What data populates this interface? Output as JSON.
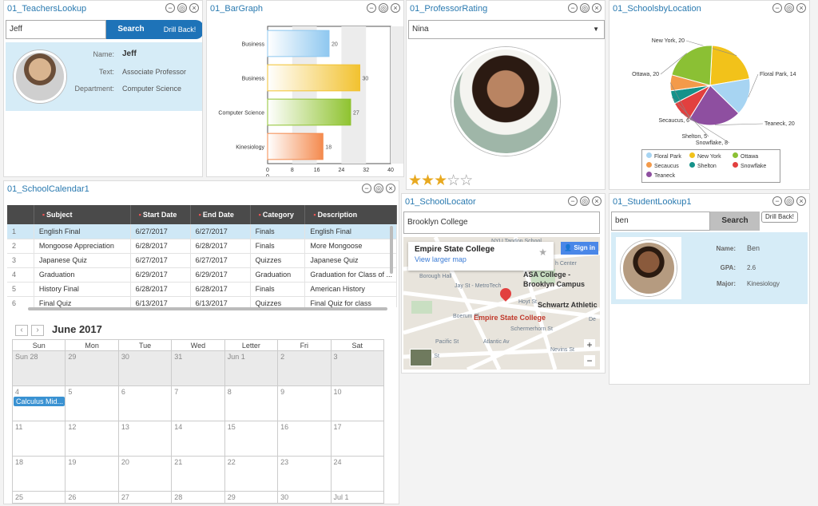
{
  "teachers": {
    "title": "01_TeachersLookup",
    "search_value": "Jeff",
    "search_label": "Search",
    "drill_label": "Drill Back!",
    "fields": [
      {
        "label": "Name:",
        "value": "Jeff"
      },
      {
        "label": "Text:",
        "value": "Associate Professor"
      },
      {
        "label": "Department:",
        "value": "Computer Science"
      }
    ]
  },
  "bargraph": {
    "title": "01_BarGraph"
  },
  "chart_data": {
    "type": "bar",
    "orientation": "horizontal",
    "categories": [
      "Business",
      "Business",
      "Computer Science",
      "Kinesiology"
    ],
    "values": [
      20,
      30,
      27,
      18
    ],
    "colors": [
      "#8fc8f0",
      "#f2c230",
      "#8fc330",
      "#f48a4e"
    ],
    "ticks": [
      "0",
      "8",
      "16",
      "24",
      "32",
      "40"
    ],
    "extra_tick": "0",
    "xlim": [
      0,
      40
    ]
  },
  "professor": {
    "title": "01_ProfessorRating",
    "select_value": "Nina",
    "rating": 3,
    "max_rating": 5,
    "star_on": "★",
    "star_off": "☆"
  },
  "schools": {
    "title": "01_SchoolsbyLocation",
    "pie": [
      {
        "label": "New York, 20",
        "value": 20,
        "color": "#f2c21a"
      },
      {
        "label": "Floral Park, 14",
        "value": 14,
        "color": "#a7d4f2"
      },
      {
        "label": "Teaneck, 20",
        "value": 20,
        "color": "#8e4fa0"
      },
      {
        "label": "Snowflake, 8",
        "value": 8,
        "color": "#e2403f"
      },
      {
        "label": "Shelton, 5",
        "value": 5,
        "color": "#16928a"
      },
      {
        "label": "Secaucus, 6",
        "value": 6,
        "color": "#f39a4a"
      },
      {
        "label": "Ottawa, 20",
        "value": 20,
        "color": "#8bc034"
      }
    ],
    "legend": [
      "Floral Park",
      "New York",
      "Ottawa",
      "Secaucus",
      "Shelton",
      "Snowflake",
      "Teaneck"
    ],
    "legend_colors": [
      "#a7d4f2",
      "#f2c21a",
      "#8bc034",
      "#f39a4a",
      "#16928a",
      "#e2403f",
      "#8e4fa0"
    ]
  },
  "calendar_grid": {
    "title": "01_SchoolCalendar1",
    "headers": [
      "Subject",
      "Start Date",
      "End Date",
      "Category",
      "Description"
    ],
    "rows": [
      [
        "1",
        "English Final",
        "6/27/2017",
        "6/27/2017",
        "Finals",
        "English Final"
      ],
      [
        "2",
        "Mongoose Appreciation",
        "6/28/2017",
        "6/28/2017",
        "Finals",
        "More Mongoose"
      ],
      [
        "3",
        "Japanese Quiz",
        "6/27/2017",
        "6/27/2017",
        "Quizzes",
        "Japanese Quiz"
      ],
      [
        "4",
        "Graduation",
        "6/29/2017",
        "6/29/2017",
        "Graduation",
        "Graduation for Class of ..."
      ],
      [
        "5",
        "History Final",
        "6/28/2017",
        "6/28/2017",
        "Finals",
        "American History"
      ],
      [
        "6",
        "Final Quiz",
        "6/13/2017",
        "6/13/2017",
        "Quizzes",
        "Final Quiz for class"
      ]
    ],
    "month": "June 2017",
    "days": [
      "Sun",
      "Mon",
      "Tue",
      "Wed",
      "Letter",
      "Fri",
      "Sat"
    ],
    "weeks": [
      [
        "Sun 28",
        "29",
        "30",
        "31",
        "Jun 1",
        "2",
        "3"
      ],
      [
        "4",
        "5",
        "6",
        "7",
        "8",
        "9",
        "10"
      ],
      [
        "11",
        "12",
        "13",
        "14",
        "15",
        "16",
        "17"
      ],
      [
        "18",
        "19",
        "20",
        "21",
        "22",
        "23",
        "24"
      ],
      [
        "25",
        "26",
        "27",
        "28",
        "29",
        "30",
        "Jul 1"
      ]
    ],
    "event": "Calculus Mid..."
  },
  "locator": {
    "title": "01_SchoolLocator",
    "input_value": "Brooklyn College",
    "card_title": "Empire State College",
    "card_link": "View larger map",
    "sign_in": "Sign in",
    "pin_label": "Empire State College",
    "map_labels": [
      "NYU Tandon School",
      "h Center",
      "Borough Hall",
      "Jay St - MetroTech",
      "ASA College -",
      "Brooklyn Campus",
      "Schwartz Athletic",
      "Hoyt St",
      "Schermerhorn St",
      "Nevins St",
      "Atlantic Av",
      "Pacific St",
      "State St",
      "Boerum Pl",
      "De"
    ]
  },
  "student": {
    "title": "01_StudentLookup1",
    "search_value": "ben",
    "search_label": "Search",
    "drill_label": "Drill Back!",
    "fields": [
      {
        "label": "Name:",
        "value": "Ben"
      },
      {
        "label": "GPA:",
        "value": "2.6"
      },
      {
        "label": "Major:",
        "value": "Kinesiology"
      }
    ]
  }
}
